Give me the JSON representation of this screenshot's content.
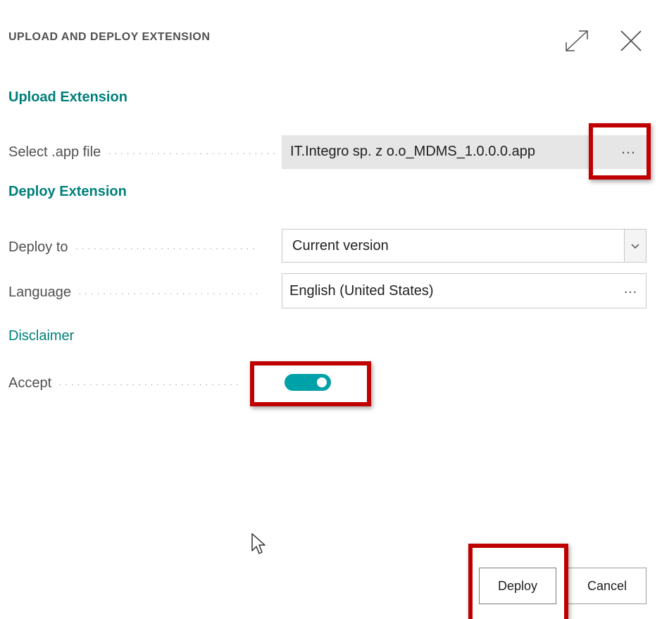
{
  "dialog": {
    "title": "UPLOAD AND DEPLOY EXTENSION",
    "icons": {
      "expand": "expand-icon",
      "close": "close-icon"
    }
  },
  "upload": {
    "section_title": "Upload Extension",
    "file_label": "Select .app file",
    "file_value": "IT.Integro sp. z o.o_MDMS_1.0.0.0.app",
    "more": "…"
  },
  "deploy": {
    "section_title": "Deploy Extension",
    "deploy_to_label": "Deploy to",
    "deploy_to_value": "Current version",
    "language_label": "Language",
    "language_value": "English (United States)",
    "language_more": "…"
  },
  "disclaimer": {
    "link": "Disclaimer",
    "accept_label": "Accept",
    "accept_value": true
  },
  "actions": {
    "deploy": "Deploy",
    "cancel": "Cancel"
  },
  "colors": {
    "accent": "#00807a",
    "toggle_on": "#00a1a8",
    "highlight": "#c00000"
  }
}
